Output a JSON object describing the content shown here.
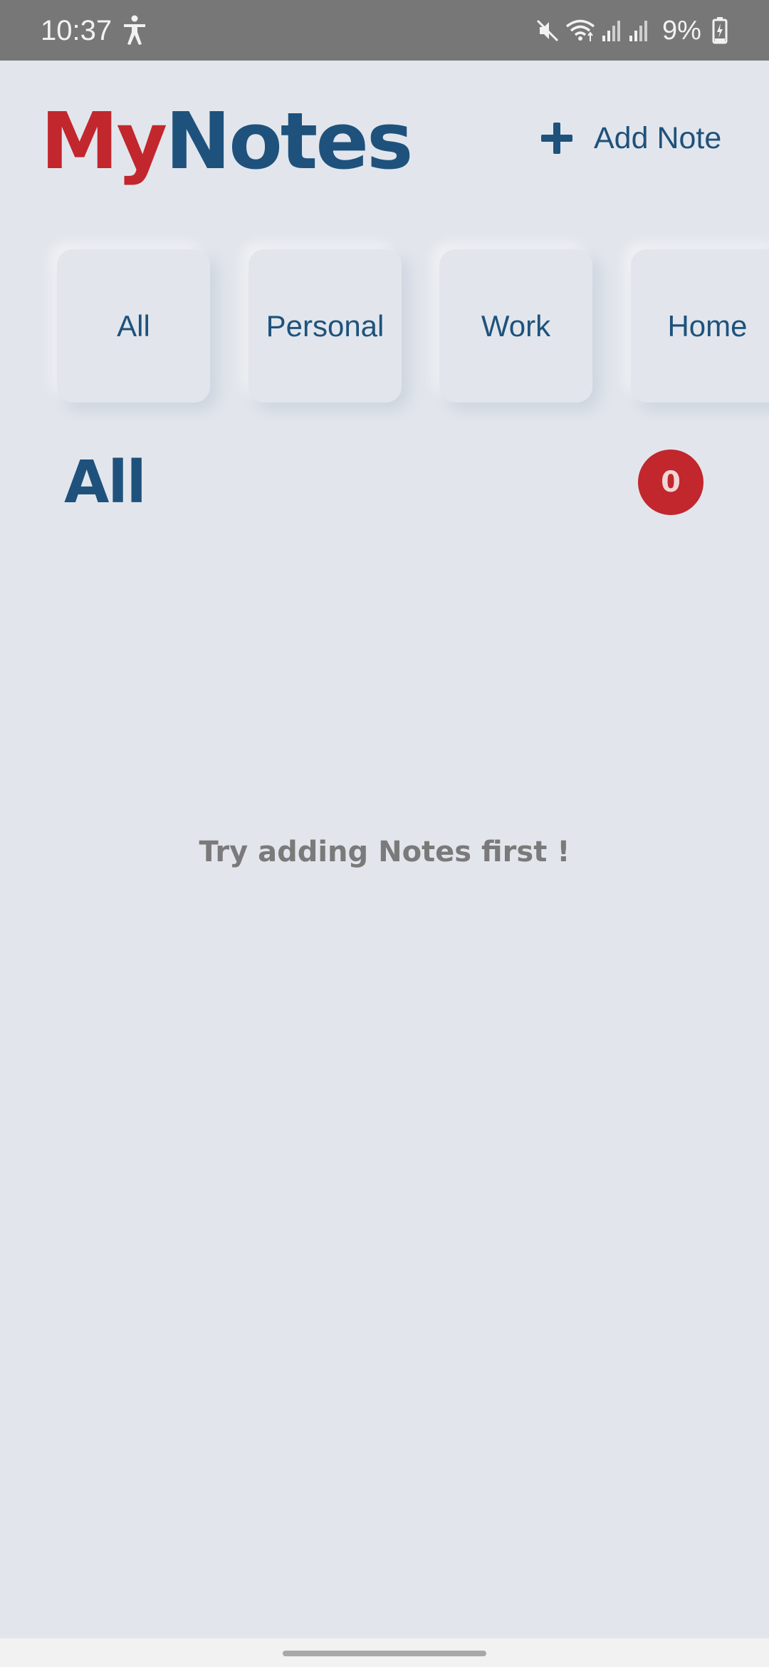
{
  "status_bar": {
    "time": "10:37",
    "battery_percent": "9%",
    "icons": [
      "accessibility-icon",
      "mute-icon",
      "wifi-icon",
      "signal-icon",
      "signal-icon",
      "battery-charging-icon"
    ]
  },
  "header": {
    "title_part1": "My",
    "title_part2": "Notes",
    "add_note_label": "Add Note",
    "add_note_icon": "plus-icon"
  },
  "categories": [
    {
      "label": "All"
    },
    {
      "label": "Personal"
    },
    {
      "label": "Work"
    },
    {
      "label": "Home"
    }
  ],
  "section": {
    "title": "All",
    "count": "0"
  },
  "empty_state": {
    "message": "Try adding Notes first !"
  },
  "colors": {
    "background": "#e2e6ec",
    "primary": "#1e527c",
    "accent": "#c1272d",
    "muted_text": "#7a7a7a",
    "status_bar": "#777777"
  }
}
